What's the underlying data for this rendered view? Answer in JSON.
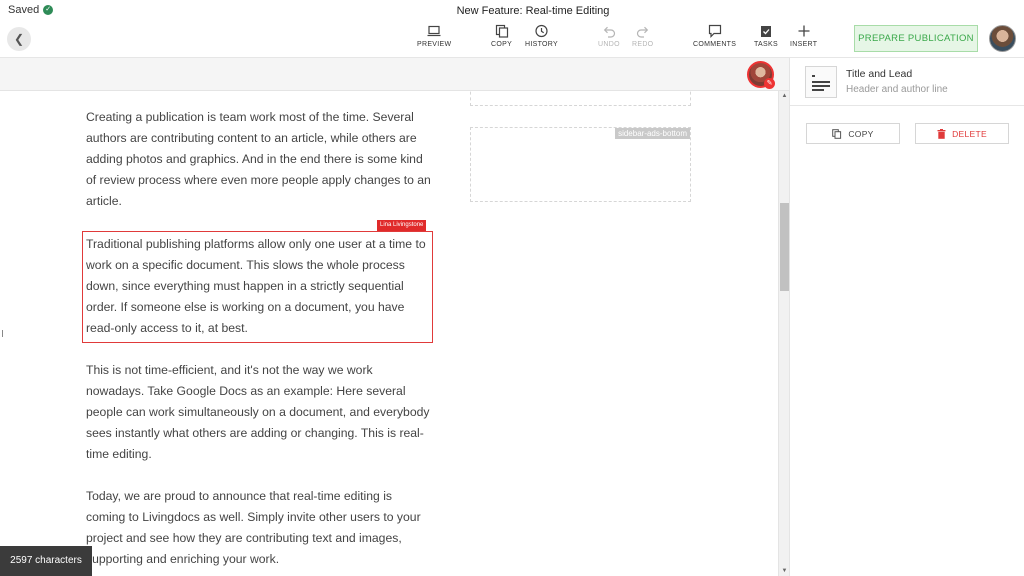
{
  "header": {
    "saved_label": "Saved",
    "document_title": "New Feature: Real-time Editing",
    "back_icon": "chevron-left-icon",
    "toolbar": [
      {
        "id": "preview",
        "label": "PREVIEW",
        "icon": "laptop-icon",
        "disabled": false
      },
      {
        "id": "copy",
        "label": "COPY",
        "icon": "copy-icon",
        "disabled": false
      },
      {
        "id": "history",
        "label": "HISTORY",
        "icon": "history-icon",
        "disabled": false
      },
      {
        "id": "undo",
        "label": "UNDO",
        "icon": "undo-icon",
        "disabled": true
      },
      {
        "id": "redo",
        "label": "REDO",
        "icon": "redo-icon",
        "disabled": true
      },
      {
        "id": "comments",
        "label": "COMMENTS",
        "icon": "comments-icon",
        "disabled": false
      },
      {
        "id": "tasks",
        "label": "TASKS",
        "icon": "tasks-icon",
        "disabled": false
      },
      {
        "id": "insert",
        "label": "INSERT",
        "icon": "plus-icon",
        "disabled": false
      }
    ],
    "prepare_button": "PREPARE PUBLICATION"
  },
  "editor": {
    "paragraphs": [
      "Creating a publication is team work most of the time. Several authors are contributing content to an article, while others are adding photos and graphics. And in the end there is some kind of review process where even more people apply changes to an article.",
      "Traditional publishing platforms allow only one user at a time to work on a specific document. This slows the whole process down, since  everything must happen in a strictly sequential order. If someone else is working on a document, you have read-only access to it, at best.",
      "This is not time-efficient, and it's not the way we work nowadays. Take Google Docs as an example: Here several people can work simultaneously on a document, and everybody sees instantly what others are adding or changing. This is real-time editing.",
      "Today, we are proud to announce that real-time editing is coming to Livingdocs as well. Simply invite other users to your project and see how they are contributing text and images, supporting and enriching your work."
    ],
    "locked_by": "Lina Livingstone",
    "ad_label": "sidebar-ads-bottom",
    "char_count": "2597 characters"
  },
  "sidebar": {
    "component_title": "Title and Lead",
    "component_subtitle": "Header and author line",
    "copy_button": "COPY",
    "delete_button": "DELETE"
  },
  "colors": {
    "accent_green": "#3aa84a",
    "lock_red": "#e02a2a",
    "delete_red": "#e03a3a"
  }
}
